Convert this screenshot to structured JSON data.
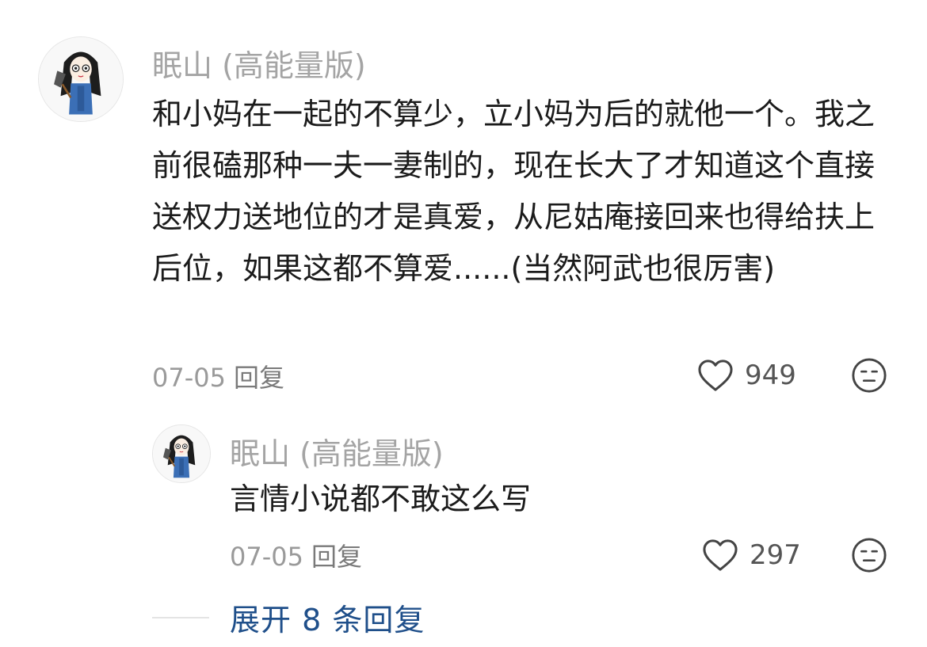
{
  "comments": [
    {
      "username": "眠山 (高能量版)",
      "content": "和小妈在一起的不算少，立小妈为后的就他一个。我之前很磕那种一夫一妻制的，现在长大了才知道这个直接送权力送地位的才是真爱，从尼姑庵接回来也得给扶上后位，如果这都不算爱......(当然阿武也很厉害)",
      "date": "07-05",
      "reply_label": "回复",
      "likes": "949",
      "like_icon": "heart-outline-icon",
      "dislike_icon": "meh-face-icon"
    }
  ],
  "replies": [
    {
      "username": "眠山 (高能量版)",
      "content": "言情小说都不敢这么写",
      "date": "07-05",
      "reply_label": "回复",
      "likes": "297",
      "like_icon": "heart-outline-icon",
      "dislike_icon": "meh-face-icon"
    }
  ],
  "expand_replies_label": "展开 8 条回复",
  "colors": {
    "username": "#a4a4a4",
    "text": "#1b1b1b",
    "meta": "#9a9a9a",
    "link": "#1f4f8a"
  }
}
